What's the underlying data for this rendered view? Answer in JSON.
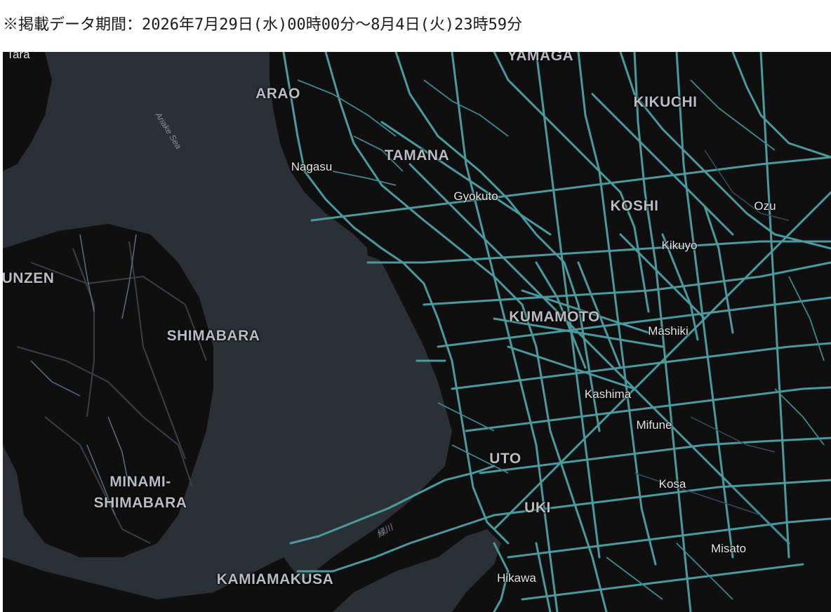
{
  "header": {
    "period_text": "※掲載データ期間：2026年7月29日(水)00時00分～8月4日(火)23時59分"
  },
  "map": {
    "background_sea": "#2b3037",
    "land_color": "#0f0f10",
    "road_color": "#4a9a9e",
    "labels": {
      "tara": "Tara",
      "arao": "ARAO",
      "yamaga": "YAMAGA",
      "kikuchi": "KIKUCHI",
      "nagasu": "Nagasu",
      "tamana": "TAMANA",
      "gyokuto": "Gyokuto",
      "koshi": "KOSHI",
      "ozu": "Ozu",
      "kikuyo": "Kikuyo",
      "unzen": "UNZEN",
      "shimabara": "SHIMABARA",
      "kumamoto": "KUMAMOTO",
      "mashiki": "Mashiki",
      "kashima": "Kashima",
      "mifune": "Mifune",
      "uto": "UTO",
      "kosa": "Kosa",
      "minamishimabara_line1": "MINAMI-",
      "minamishimabara_line2": "SHIMABARA",
      "uki": "UKI",
      "misato": "Misato",
      "kamiamakusa": "KAMIAMAKUSA",
      "hikawa": "Hikawa",
      "ariake_sea": "Ariake Sea",
      "river": "緑川"
    }
  }
}
